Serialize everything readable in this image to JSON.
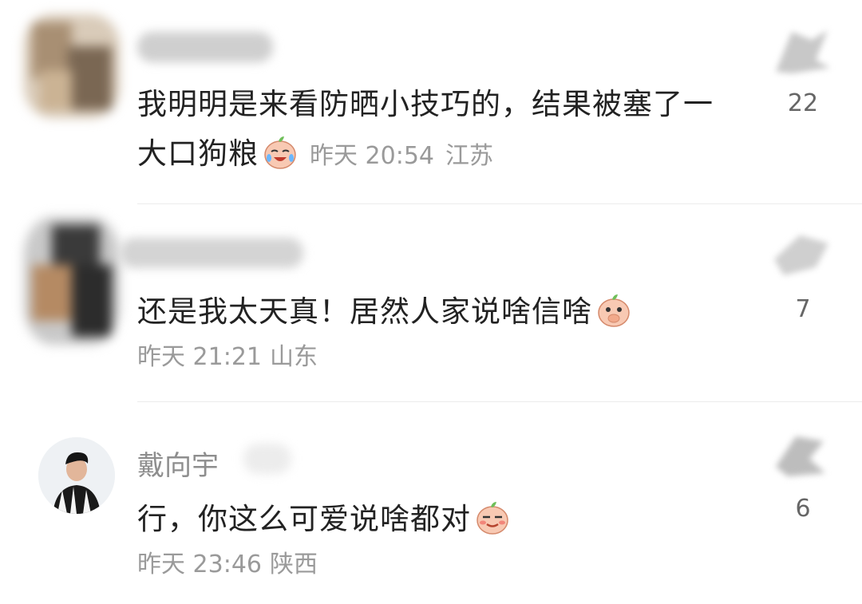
{
  "comments": [
    {
      "username": "",
      "text": "我明明是来看防晒小技巧的，结果被塞了一大口狗粮",
      "emoji": "laughing-tears-peach-emoji",
      "time": "昨天 20:54",
      "location": "江苏",
      "likes": "22",
      "avatar": "blurred-avatar"
    },
    {
      "username": "",
      "text": "还是我太天真！居然人家说啥信啥",
      "emoji": "covering-mouth-peach-emoji",
      "time": "昨天 21:21",
      "location": "山东",
      "likes": "7",
      "avatar": "blurred-avatar"
    },
    {
      "username": "戴向宇",
      "text": "行，你这么可爱说啥都对",
      "emoji": "smirk-peach-emoji",
      "time": "昨天 23:46",
      "location": "陕西",
      "likes": "6",
      "avatar": "user-photo-avatar"
    }
  ],
  "colors": {
    "text": "#222222",
    "meta": "#9a9a9a",
    "divider": "#ececec"
  }
}
